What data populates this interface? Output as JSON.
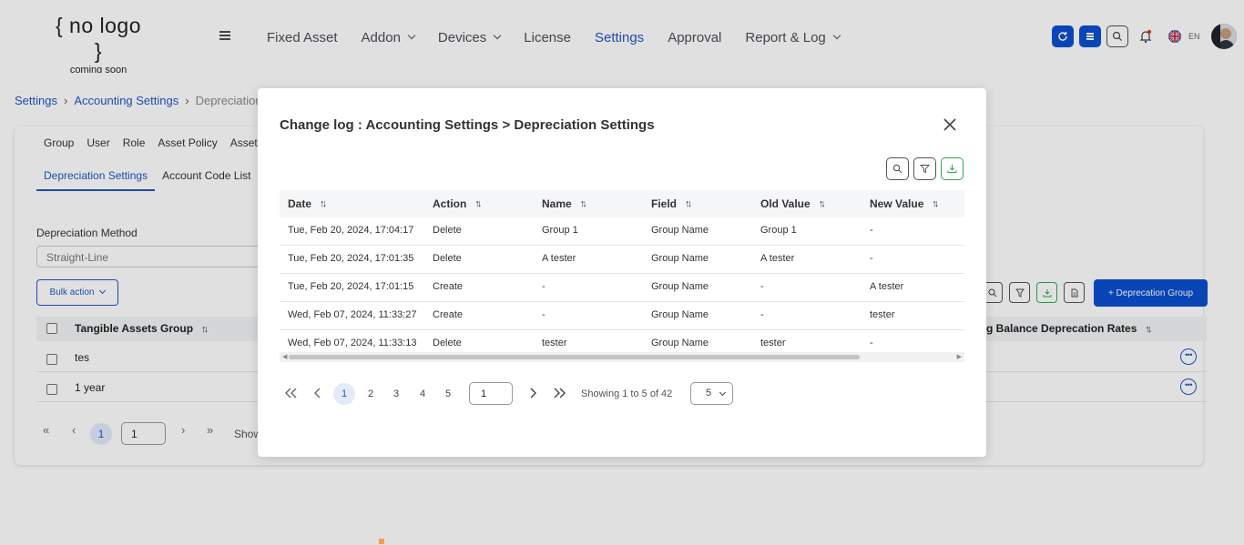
{
  "header": {
    "logo_main": "{ no logo }",
    "logo_sub": "coming soon",
    "nav": [
      {
        "label": "Fixed Asset"
      },
      {
        "label": "Addon"
      },
      {
        "label": "Devices"
      },
      {
        "label": "License"
      },
      {
        "label": "Settings"
      },
      {
        "label": "Approval"
      },
      {
        "label": "Report & Log"
      }
    ],
    "lang": "EN",
    "accent": "#0b4fd1"
  },
  "background": {
    "breadcrumb": [
      "Settings",
      "Accounting Settings",
      "Depreciation"
    ],
    "tabs_top": [
      "Group",
      "User",
      "Role",
      "Asset Policy",
      "Asset"
    ],
    "tabs_sub": [
      "Depreciation Settings",
      "Account Code List"
    ],
    "dep_method_label": "Depreciation Method",
    "dep_method_value": "Straight-Line",
    "bulk_action": "Bulk action",
    "add_group_button": "+   Deprecation Group",
    "col_group": "Tangible Assets Group",
    "col_rates": "g Balance Deprecation Rates",
    "rows": [
      "tes",
      "1 year"
    ],
    "page_current": "1",
    "page_input": "1",
    "showing_partial": "Show"
  },
  "modal": {
    "title": "Change log : Accounting Settings > Depreciation Settings",
    "columns": [
      "Date",
      "Action",
      "Name",
      "Field",
      "Old Value",
      "New Value"
    ],
    "rows": [
      {
        "date": "Tue, Feb 20, 2024, 17:04:17",
        "action": "Delete",
        "name": "Group 1",
        "field": "Group Name",
        "old": "Group 1",
        "new": "-"
      },
      {
        "date": "Tue, Feb 20, 2024, 17:01:35",
        "action": "Delete",
        "name": "A tester",
        "field": "Group Name",
        "old": "A tester",
        "new": "-"
      },
      {
        "date": "Tue, Feb 20, 2024, 17:01:15",
        "action": "Create",
        "name": "-",
        "field": "Group Name",
        "old": "-",
        "new": "A tester"
      },
      {
        "date": "Wed, Feb 07, 2024, 11:33:27",
        "action": "Create",
        "name": "-",
        "field": "Group Name",
        "old": "-",
        "new": "tester"
      },
      {
        "date": "Wed, Feb 07, 2024, 11:33:13",
        "action": "Delete",
        "name": "tester",
        "field": "Group Name",
        "old": "tester",
        "new": "-"
      }
    ],
    "pages": [
      "1",
      "2",
      "3",
      "4",
      "5"
    ],
    "page_input": "1",
    "showing": "Showing 1 to 5 of 42",
    "per_page": "5"
  }
}
